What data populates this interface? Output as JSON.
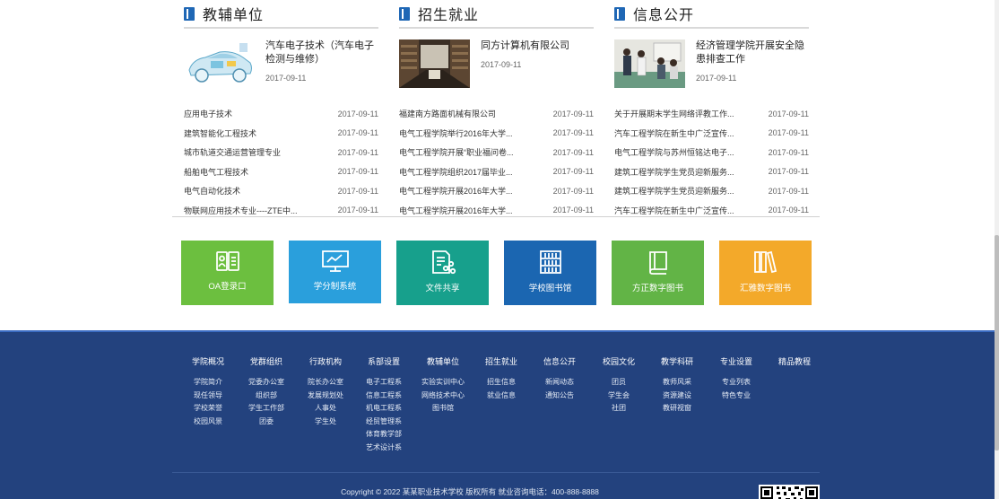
{
  "columns": [
    {
      "title": "教辅单位",
      "feature": {
        "title": "汽车电子技术（汽车电子检测与维修）",
        "date": "2017-09-11",
        "image": "car-schematic"
      },
      "items": [
        {
          "text": "应用电子技术",
          "date": "2017-09-11"
        },
        {
          "text": "建筑智能化工程技术",
          "date": "2017-09-11"
        },
        {
          "text": "城市轨道交通运营管理专业",
          "date": "2017-09-11"
        },
        {
          "text": "船舶电气工程技术",
          "date": "2017-09-11"
        },
        {
          "text": "电气自动化技术",
          "date": "2017-09-11"
        },
        {
          "text": "物联网应用技术专业----ZTE中...",
          "date": "2017-09-11"
        }
      ]
    },
    {
      "title": "招生就业",
      "feature": {
        "title": "同方计算机有限公司",
        "date": "2017-09-11",
        "image": "library-hall"
      },
      "items": [
        {
          "text": "福建南方路面机械有限公司",
          "date": "2017-09-11"
        },
        {
          "text": "电气工程学院举行2016年大学...",
          "date": "2017-09-11"
        },
        {
          "text": "电气工程学院开展“职业福问卷...",
          "date": "2017-09-11"
        },
        {
          "text": "电气工程学院组织2017届毕业...",
          "date": "2017-09-11"
        },
        {
          "text": "电气工程学院开展2016年大学...",
          "date": "2017-09-11"
        },
        {
          "text": "电气工程学院开展2016年大学...",
          "date": "2017-09-11"
        }
      ]
    },
    {
      "title": "信息公开",
      "feature": {
        "title": "经济管理学院开展安全隐患排查工作",
        "date": "2017-09-11",
        "image": "people-meeting"
      },
      "items": [
        {
          "text": "关于开展期末学生网络评教工作...",
          "date": "2017-09-11"
        },
        {
          "text": "汽车工程学院在新生中广泛宣传...",
          "date": "2017-09-11"
        },
        {
          "text": "电气工程学院与苏州恒铭达电子...",
          "date": "2017-09-11"
        },
        {
          "text": "建筑工程学院学生党员迎新服务...",
          "date": "2017-09-11"
        },
        {
          "text": "建筑工程学院学生党员迎新服务...",
          "date": "2017-09-11"
        },
        {
          "text": "汽车工程学院在新生中广泛宣传...",
          "date": "2017-09-11"
        }
      ]
    }
  ],
  "tiles": [
    {
      "label": "OA登录口",
      "color": "#6cbf3f",
      "icon": "id-card-icon"
    },
    {
      "label": "学分制系统",
      "color": "#2a9fdc",
      "icon": "monitor-chart-icon"
    },
    {
      "label": "文件共享",
      "color": "#17a08c",
      "icon": "document-share-icon"
    },
    {
      "label": "学校图书馆",
      "color": "#1b66b1",
      "icon": "bookshelf-icon"
    },
    {
      "label": "方正数字图书",
      "color": "#62b446",
      "icon": "book-icon"
    },
    {
      "label": "汇雅数字图书",
      "color": "#f3a92a",
      "icon": "books-icon"
    }
  ],
  "footer": {
    "columns": [
      {
        "heading": "学院概况",
        "items": [
          "学院简介",
          "现任领导",
          "学校荣誉",
          "校园风景"
        ]
      },
      {
        "heading": "党群组织",
        "items": [
          "党委办公室",
          "组织部",
          "学生工作部",
          "团委"
        ]
      },
      {
        "heading": "行政机构",
        "items": [
          "院长办公室",
          "发展规划处",
          "人事处",
          "学生处"
        ]
      },
      {
        "heading": "系部设置",
        "items": [
          "电子工程系",
          "信息工程系",
          "机电工程系",
          "经贸管理系",
          "体育教学部",
          "艺术设计系"
        ]
      },
      {
        "heading": "教辅单位",
        "items": [
          "实验实训中心",
          "网络技术中心",
          "图书馆"
        ]
      },
      {
        "heading": "招生就业",
        "items": [
          "招生信息",
          "就业信息"
        ]
      },
      {
        "heading": "信息公开",
        "items": [
          "新闻动态",
          "通知公告"
        ]
      },
      {
        "heading": "校园文化",
        "items": [
          "团员",
          "学生会",
          "社团"
        ]
      },
      {
        "heading": "教学科研",
        "items": [
          "教师风采",
          "资源建设",
          "教研视窗"
        ]
      },
      {
        "heading": "专业设置",
        "items": [
          "专业列表",
          "特色专业"
        ]
      },
      {
        "heading": "精品教程",
        "items": []
      }
    ],
    "copyright": "Copyright © 2022 某某职业技术学校 版权所有 就业咨询电话：400-888-8888"
  }
}
